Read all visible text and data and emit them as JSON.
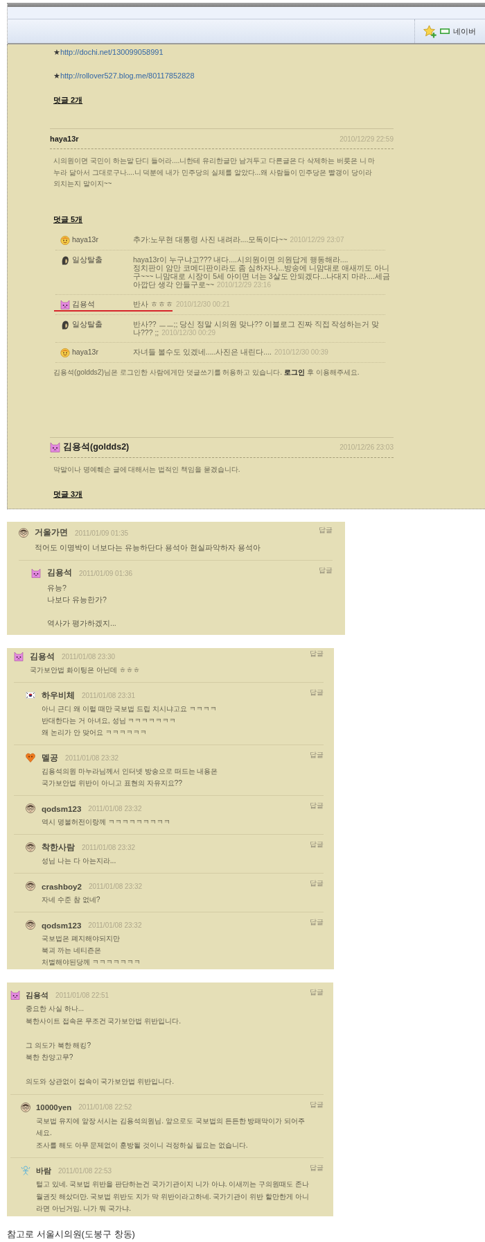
{
  "browser_toolbar": {
    "bookmark": "네이버"
  },
  "post": {
    "links": [
      {
        "bullet": "★",
        "url": "http://dochi.net/130099058991"
      },
      {
        "bullet": "★",
        "url": "http://rollover527.blog.me/80117852828"
      }
    ],
    "comment_count": "덧글 2개"
  },
  "entries": [
    {
      "author": "haya13r",
      "date": "2010/12/29 22:59",
      "body": "시의원이면 국민이 하는말 단디 들어라....니한테 유리한글만 남겨두고 다른글은 다 삭제하는 버릇은 니 마\n누라 닮아서 그대로구나....니 덕분에 내가 민주당의 실체를 알았다...왜 사람들이 민주당은 빨갱이 당이라\n외치는지 말이지~~",
      "comment_count": "덧글 5개",
      "comments": [
        {
          "avatar": {
            "kind": "smiley"
          },
          "author": "haya13r",
          "lines": [
            "추가:노무현 대통령 사진 내려라....모독이다~~"
          ],
          "date": "2010/12/29 23:07",
          "underlined": false
        },
        {
          "avatar": {
            "kind": "silhouette"
          },
          "author": "일상탈출",
          "lines": [
            "haya13r이 누구냐고??? 내다....시의원이면 의원답게 행동해라....",
            "정치판이 암만 코메디판이라도 좀 심하자나...방송에 니맘대로 애새끼도 아니",
            "구~~~ 니맘대로 시장이 5세 아이면 너는 3살도 안되겠다...나대지 마라....세금",
            "아깝단 생각 안들구로~~"
          ],
          "date": "2010/12/29 23:16",
          "underlined": false
        },
        {
          "avatar": {
            "kind": "pink-cat"
          },
          "author": "김용석",
          "lines": [
            "반사 ㅎㅎㅎ"
          ],
          "date": "2010/12/30 00:21",
          "underlined": true
        },
        {
          "avatar": {
            "kind": "silhouette"
          },
          "author": "일상탈출",
          "lines": [
            "반사?? ㅡㅡ;; 당신 정말 시의원 맞나?? 이블로그 진짜 직접 작성하는거 맞",
            "나??? ;;"
          ],
          "date": "2010/12/30 00:29",
          "underlined": false
        },
        {
          "avatar": {
            "kind": "smiley"
          },
          "author": "haya13r",
          "lines": [
            "자녀들 볼수도 있겠네.....사진은 내린다...."
          ],
          "date": "2010/12/30 00:39",
          "underlined": false
        }
      ],
      "notice": {
        "before": "김용석(goldds2)님은 로그인한 사람에게만 덧글쓰기를 허용하고 있습니다. ",
        "link": "로그인",
        "after": " 후 이용해주세요."
      }
    },
    {
      "avatar": {
        "kind": "pink-cat"
      },
      "author": "김용석(goldds2)",
      "date": "2010/12/26 23:03",
      "body": "막말이나 명예훼손 글에 대해서는 법적인 책임을 묻겠습니다.",
      "comment_count": "덧글 3개"
    }
  ],
  "threads": [
    {
      "avatar": {
        "kind": "glasses-face"
      },
      "author": "거울가면",
      "date": "2011/01/09 01:35",
      "reply_label": "답글",
      "text": "적어도 이명박이 너보다는 유능하단다 용석아 현실파악하자 용석아",
      "replies": [
        {
          "avatar": {
            "kind": "pink-cat"
          },
          "author": "김용석",
          "date": "2011/01/09 01:36",
          "reply_label": "답글",
          "text": "유능?\n나보다 유능한가?\n\n역사가 평가하겠지..."
        }
      ]
    },
    {
      "avatar": {
        "kind": "pink-cat"
      },
      "author": "김용석",
      "date": "2011/01/08 23:30",
      "reply_label": "답글",
      "text": "국가보안법 화이팅은 아닌데 ㅎㅎㅎ",
      "replies": [
        {
          "avatar": {
            "kind": "flag"
          },
          "author": "하우비체",
          "date": "2011/01/08 23:31",
          "reply_label": "답글",
          "text": "아니 근디 왜 이럴 때만 국보법 드립 치시냐고요 ㅋㅋㅋㅋ\n반대한다는 거 아녀요, 성님 ㅋㅋㅋㅋㅋㅋㅋ\n왜 논리가 안 맞어요 ㅋㅋㅋㅋㅋㅋ"
        },
        {
          "avatar": {
            "kind": "heart"
          },
          "author": "멜공",
          "date": "2011/01/08 23:32",
          "reply_label": "답글",
          "text": "김용석의원 마누라님께서 인터넷 방송으로 떠드는 내용은\n국가보안법 위반이 아니고 표현의 자유지요??"
        },
        {
          "avatar": {
            "kind": "glasses-face"
          },
          "author": "qodsm123",
          "date": "2011/01/08 23:32",
          "reply_label": "답글",
          "text": "역시 명불허전이랑께 ㅋㅋㅋㅋㅋㅋㅋㅋㅋ"
        },
        {
          "avatar": {
            "kind": "glasses-face"
          },
          "author": "착한사람",
          "date": "2011/01/08 23:32",
          "reply_label": "답글",
          "text": "성님 나는 다 아는지라..."
        },
        {
          "avatar": {
            "kind": "glasses-face"
          },
          "author": "crashboy2",
          "date": "2011/01/08 23:32",
          "reply_label": "답글",
          "text": "자네 수준 참 없네?"
        },
        {
          "avatar": {
            "kind": "glasses-face"
          },
          "author": "qodsm123",
          "date": "2011/01/08 23:32",
          "reply_label": "답글",
          "text": "국보법은 폐지해야되지만\n북괴 까는 네티즌은\n처벌해야된당께 ㅋㅋㅋㅋㅋㅋㅋ"
        }
      ]
    },
    {
      "avatar": {
        "kind": "pink-cat"
      },
      "author": "김용석",
      "date": "2011/01/08 22:51",
      "reply_label": "답글",
      "text": "중요한 사실 하나...\n북한사이트 접속은 무조건 국가보안법 위반입니다.\n\n그 의도가 북한 해킹?\n북한 찬양고무?\n\n의도와 상관없이 접속이 국가보안법 위반입니다.",
      "replies": [
        {
          "avatar": {
            "kind": "glasses-face"
          },
          "author": "10000yen",
          "date": "2011/01/08 22:52",
          "reply_label": "답글",
          "text": "국보법 유지에 앞장 서시는 김용석의원님. 앞으로도 국보법의 든든한 방패막이가 되어주\n세요.\n조사를 해도 아무 문제없이 훈방될 것이니 걱정하실 필요는 없습니다."
        },
        {
          "avatar": {
            "kind": "doodle"
          },
          "author": "바람",
          "date": "2011/01/08 22:53",
          "reply_label": "답글",
          "text": "털고 있네. 국보법 위반을 판단하는건 국가기관이지 니가 아냐. 이새끼는 구의원때도 존나\n월권짓 해샀더만. 국보법 위반도 지가 막 위반이라고하네. 국가기관이 위반 할만한게 아니\n라면 아닌거임. 니가 뭐 국가냐."
        }
      ]
    }
  ],
  "footer_note": "참고로 서울시의원(도봉구 창동)"
}
